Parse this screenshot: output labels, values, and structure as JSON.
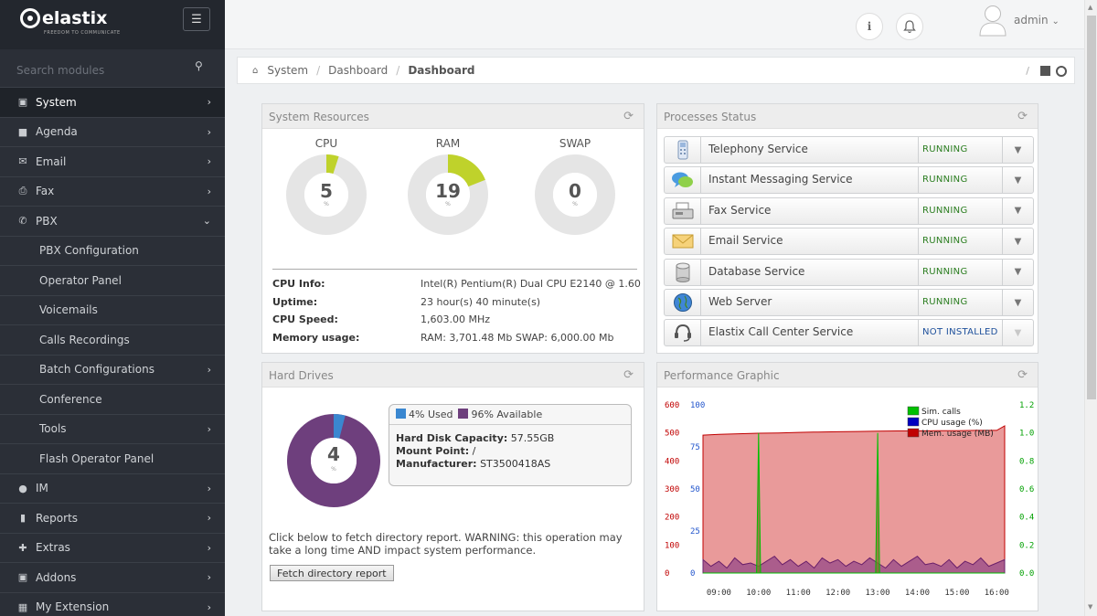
{
  "app": {
    "logo_text": "elastix",
    "logo_tagline": "FREEDOM TO COMMUNICATE"
  },
  "sidebar": {
    "search_placeholder": "Search modules",
    "items": [
      {
        "label": "System",
        "icon": "laptop-icon",
        "expandable": true,
        "state": "active"
      },
      {
        "label": "Agenda",
        "icon": "book-icon",
        "expandable": true
      },
      {
        "label": "Email",
        "icon": "envelope-icon",
        "expandable": true
      },
      {
        "label": "Fax",
        "icon": "printer-icon",
        "expandable": true
      },
      {
        "label": "PBX",
        "icon": "phone-icon",
        "expandable": true,
        "state": "open"
      }
    ],
    "pbx_sub": [
      {
        "label": "PBX Configuration",
        "chev": false
      },
      {
        "label": "Operator Panel",
        "chev": false
      },
      {
        "label": "Voicemails",
        "chev": false
      },
      {
        "label": "Calls Recordings",
        "chev": false
      },
      {
        "label": "Batch Configurations",
        "chev": true
      },
      {
        "label": "Conference",
        "chev": false
      },
      {
        "label": "Tools",
        "chev": true
      },
      {
        "label": "Flash Operator Panel",
        "chev": false
      }
    ],
    "items_after": [
      {
        "label": "IM",
        "icon": "chat-icon"
      },
      {
        "label": "Reports",
        "icon": "bar-chart-icon"
      },
      {
        "label": "Extras",
        "icon": "plus-icon"
      },
      {
        "label": "Addons",
        "icon": "cubes-icon"
      },
      {
        "label": "My Extension",
        "icon": "extension-icon"
      }
    ]
  },
  "topbar": {
    "user": "admin"
  },
  "breadcrumb": {
    "items": [
      "System",
      "Dashboard",
      "Dashboard"
    ]
  },
  "system_resources": {
    "title": "System Resources",
    "gauges": [
      {
        "label": "CPU",
        "value": "5",
        "unit": "%",
        "fraction": 0.05
      },
      {
        "label": "RAM",
        "value": "19",
        "unit": "%",
        "fraction": 0.19
      },
      {
        "label": "SWAP",
        "value": "0",
        "unit": "%",
        "fraction": 0.0
      }
    ],
    "info": [
      {
        "key": "CPU Info:",
        "value": "Intel(R) Pentium(R) Dual CPU E2140 @ 1.60"
      },
      {
        "key": "Uptime:",
        "value": "23 hour(s) 40 minute(s)"
      },
      {
        "key": "CPU Speed:",
        "value": "1,603.00 MHz"
      },
      {
        "key": "Memory usage:",
        "value": "RAM: 3,701.48 Mb SWAP: 6,000.00 Mb"
      }
    ]
  },
  "processes": {
    "title": "Processes Status",
    "items": [
      {
        "name": "Telephony Service",
        "status": "RUNNING",
        "icon": "telephony-icon"
      },
      {
        "name": "Instant Messaging Service",
        "status": "RUNNING",
        "icon": "chat-bubbles-icon"
      },
      {
        "name": "Fax Service",
        "status": "RUNNING",
        "icon": "fax-machine-icon"
      },
      {
        "name": "Email Service",
        "status": "RUNNING",
        "icon": "envelope-icon"
      },
      {
        "name": "Database Service",
        "status": "RUNNING",
        "icon": "database-icon"
      },
      {
        "name": "Web Server",
        "status": "RUNNING",
        "icon": "globe-icon"
      },
      {
        "name": "Elastix Call Center Service",
        "status": "NOT INSTALLED",
        "icon": "headset-icon"
      }
    ]
  },
  "hard_drives": {
    "title": "Hard Drives",
    "used_percent_value": "4",
    "unit": "%",
    "legend_used": "4% Used",
    "legend_available": "96% Available",
    "capacity_key": "Hard Disk Capacity:",
    "capacity": "57.55GB",
    "mount_key": "Mount Point:",
    "mount": "/",
    "manufacturer_key": "Manufacturer:",
    "manufacturer": "ST3500418AS",
    "warning": "Click below to fetch directory report. WARNING: this operation may take a long time AND impact system performance.",
    "fetch_label": "Fetch directory report",
    "colors": {
      "used": "#3a87d0",
      "available": "#6e3f7d"
    }
  },
  "performance": {
    "title": "Performance Graphic",
    "legend": [
      {
        "label": "Sim. calls",
        "color": "#00c000"
      },
      {
        "label": "CPU usage (%)",
        "color": "#0000c0"
      },
      {
        "label": "Mem. usage (MB)",
        "color": "#c00000"
      }
    ]
  },
  "chart_data": {
    "type": "area",
    "x_ticks": [
      "09:00",
      "10:00",
      "11:00",
      "12:00",
      "13:00",
      "14:00",
      "15:00",
      "16:00"
    ],
    "y_left_mem_ticks": [
      "600",
      "500",
      "400",
      "300",
      "200",
      "100",
      "0"
    ],
    "y_left_cpu_ticks": [
      "100",
      "75",
      "50",
      "25",
      "0"
    ],
    "y_right_calls_ticks": [
      "1.2",
      "1.0",
      "0.8",
      "0.6",
      "0.4",
      "0.2",
      "0.0"
    ],
    "series": [
      {
        "name": "Mem. usage (MB)",
        "axis": "mem",
        "ylim": [
          0,
          600
        ],
        "x": [
          8.6,
          9.0,
          9.5,
          10.0,
          10.5,
          11.0,
          11.5,
          12.0,
          12.5,
          13.0,
          13.5,
          14.0,
          14.5,
          15.0,
          15.5,
          16.0,
          16.2
        ],
        "values": [
          492,
          495,
          497,
          499,
          500,
          502,
          503,
          504,
          505,
          506,
          507,
          507,
          508,
          508,
          509,
          509,
          525
        ]
      },
      {
        "name": "CPU usage (%)",
        "axis": "cpu",
        "ylim": [
          0,
          100
        ],
        "x": [
          8.6,
          8.8,
          9.0,
          9.2,
          9.4,
          9.6,
          9.8,
          10.0,
          10.2,
          10.4,
          10.6,
          10.8,
          11.0,
          11.2,
          11.4,
          11.6,
          11.8,
          12.0,
          12.2,
          12.4,
          12.6,
          12.8,
          13.0,
          13.2,
          13.4,
          13.6,
          13.8,
          14.0,
          14.2,
          14.4,
          14.6,
          14.8,
          15.0,
          15.2,
          15.4,
          15.6,
          15.8,
          16.0,
          16.2
        ],
        "values": [
          8,
          4,
          7,
          3,
          9,
          5,
          6,
          4,
          7,
          10,
          5,
          8,
          4,
          7,
          3,
          9,
          6,
          8,
          4,
          7,
          5,
          9,
          6,
          3,
          8,
          4,
          7,
          10,
          5,
          6,
          4,
          8,
          3,
          7,
          5,
          9,
          4,
          6,
          8
        ]
      },
      {
        "name": "Sim. calls",
        "axis": "calls",
        "ylim": [
          0,
          1.2
        ],
        "x": [
          8.6,
          9.95,
          10.0,
          10.05,
          12.95,
          13.0,
          13.05,
          16.2
        ],
        "values": [
          0,
          0,
          1,
          0,
          0,
          1,
          0,
          0
        ]
      }
    ],
    "x_range": [
      8.6,
      16.2
    ],
    "grid": false,
    "legend_position": "top-right"
  }
}
